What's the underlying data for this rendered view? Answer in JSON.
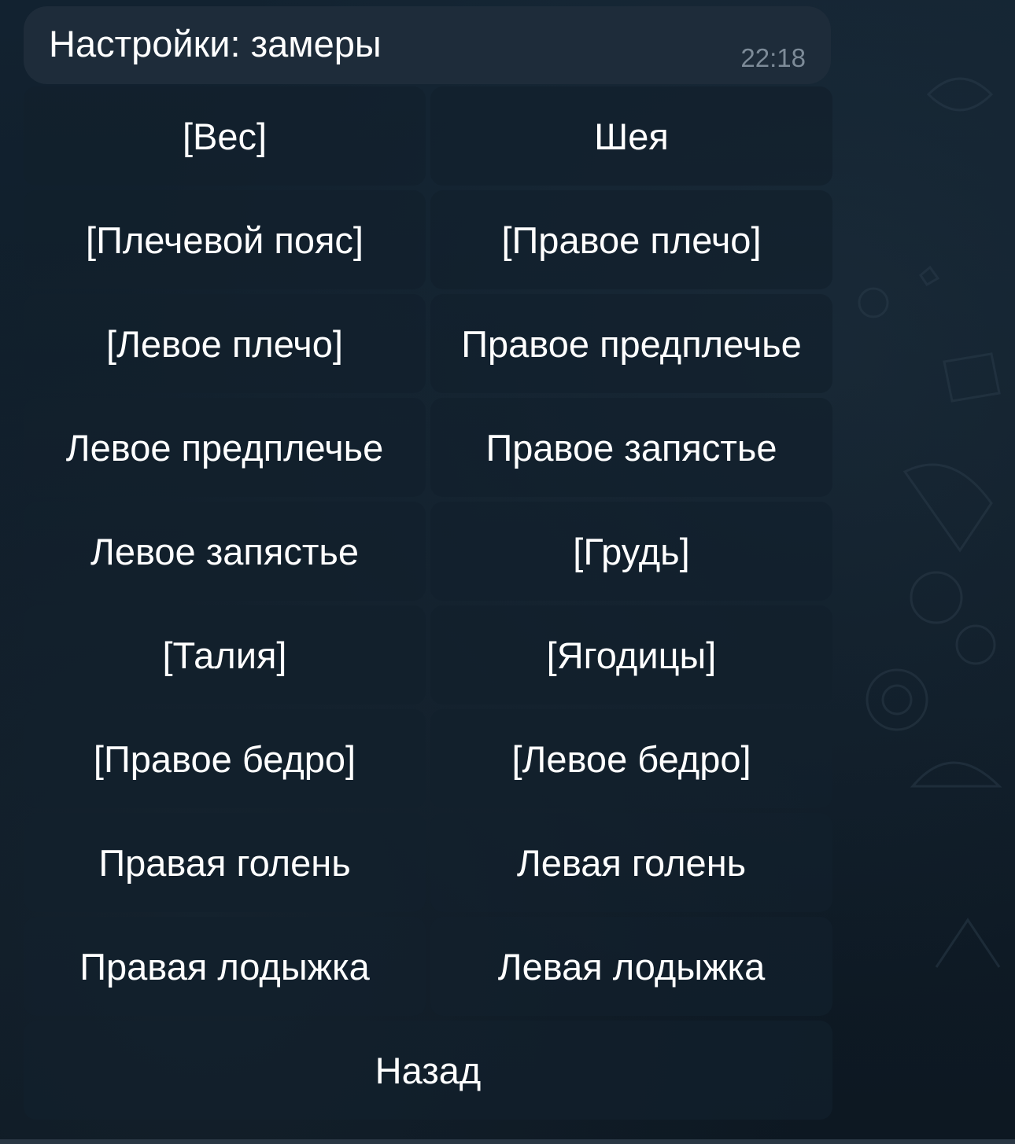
{
  "message": {
    "text": "Настройки: замеры",
    "time": "22:18"
  },
  "keyboard": {
    "rows": [
      [
        "[Вес]",
        "Шея"
      ],
      [
        "[Плечевой пояс]",
        "[Правое плечо]"
      ],
      [
        "[Левое плечо]",
        "Правое предплечье"
      ],
      [
        "Левое предплечье",
        "Правое запястье"
      ],
      [
        "Левое запястье",
        "[Грудь]"
      ],
      [
        "[Талия]",
        "[Ягодицы]"
      ],
      [
        "[Правое бедро]",
        "[Левое бедро]"
      ],
      [
        "Правая голень",
        "Левая голень"
      ],
      [
        "Правая лодыжка",
        "Левая лодыжка"
      ],
      [
        "Назад"
      ]
    ]
  },
  "colors": {
    "bubble": "#1e2c3a",
    "button_text": "#ffffff",
    "time_text": "#7d8b98",
    "background": "#0e1a24"
  }
}
